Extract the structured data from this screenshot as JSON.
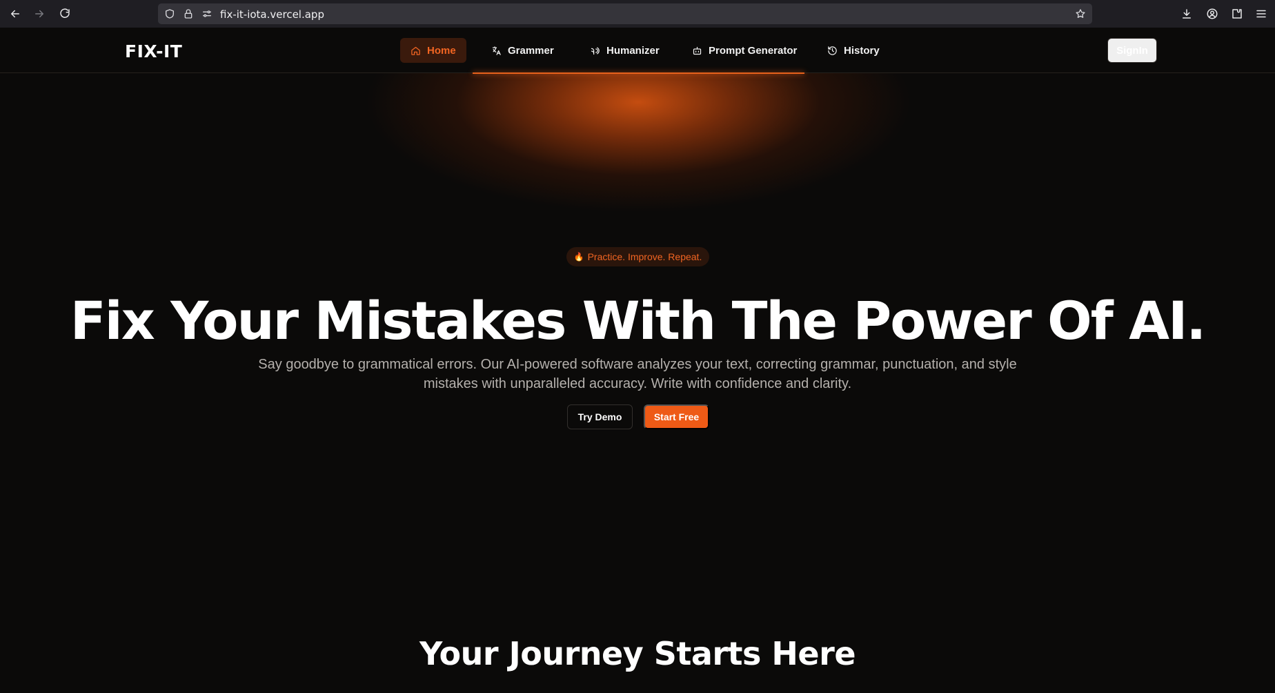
{
  "browser": {
    "url": "fix-it-iota.vercel.app"
  },
  "header": {
    "logo": "FIX-IT",
    "nav": [
      {
        "label": "Home",
        "icon": "home-icon",
        "active": true
      },
      {
        "label": "Grammer",
        "icon": "translate-icon",
        "active": false
      },
      {
        "label": "Humanizer",
        "icon": "voice-icon",
        "active": false
      },
      {
        "label": "Prompt Generator",
        "icon": "robot-icon",
        "active": false
      },
      {
        "label": "History",
        "icon": "history-icon",
        "active": false
      }
    ],
    "signin_label": "SignIn"
  },
  "hero": {
    "badge_icon": "🔥",
    "badge_text": "Practice. Improve. Repeat.",
    "title": "Fix Your Mistakes With The Power Of AI.",
    "subtitle": "Say goodbye to grammatical errors. Our AI-powered software analyzes your text, correcting grammar, punctuation, and style mistakes with unparalleled accuracy. Write with confidence and clarity.",
    "try_demo_label": "Try Demo",
    "start_free_label": "Start Free"
  },
  "journey": {
    "title": "Your Journey Starts Here"
  },
  "colors": {
    "accent": "#ee5a16",
    "background": "#0b0a09"
  }
}
